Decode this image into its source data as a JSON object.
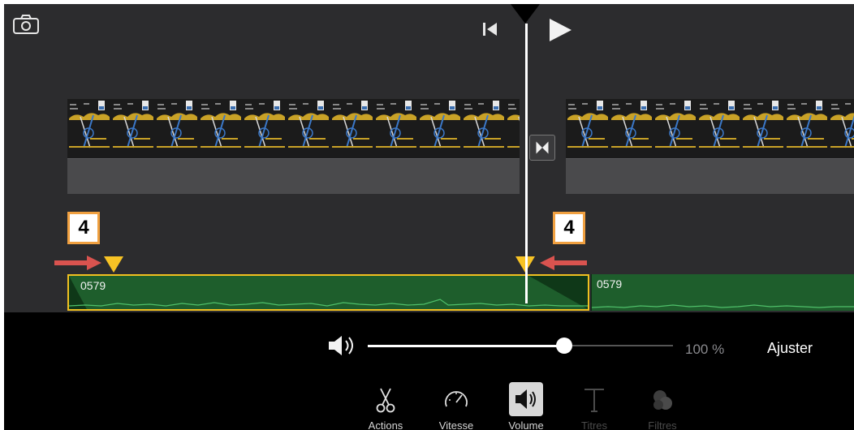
{
  "editor": {
    "clip_1": {
      "audio_name": "0579"
    },
    "clip_2": {
      "audio_name": "0579"
    },
    "annotations": {
      "left_number": "4",
      "right_number": "4"
    }
  },
  "icons": {
    "camera": "camera-icon",
    "rewind": "skip-back-icon",
    "play": "play-icon",
    "transition": "transition-icon",
    "speaker": "speaker-icon"
  },
  "volume_bar": {
    "level": 1.0,
    "value_text": "100 %",
    "adjust_label": "Ajuster"
  },
  "toolbar": {
    "items": [
      {
        "label": "Actions",
        "icon": "scissors-icon",
        "enabled": true
      },
      {
        "label": "Vitesse",
        "icon": "speedometer-icon",
        "enabled": true
      },
      {
        "label": "Volume",
        "icon": "volume-icon",
        "enabled": true,
        "selected": true
      },
      {
        "label": "Titres",
        "icon": "title-icon",
        "enabled": false
      },
      {
        "label": "Filtres",
        "icon": "filters-icon",
        "enabled": false
      }
    ]
  },
  "colors": {
    "editor_bg": "#2c2c2e",
    "audio_clip": "#1e5e2c",
    "selection": "#f0c020",
    "fade_handle": "#f7c325",
    "annotation_arrow": "#d9534f",
    "annotation_border": "#f0a040"
  }
}
